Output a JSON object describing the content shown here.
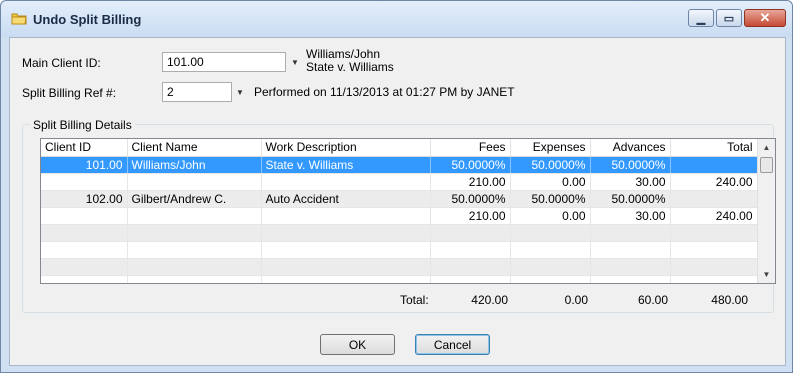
{
  "window": {
    "title": "Undo Split Billing"
  },
  "form": {
    "main_client_label": "Main Client ID:",
    "main_client_value": "101.00",
    "main_client_name": "Williams/John",
    "main_client_case": "State v. Williams",
    "split_ref_label": "Split Billing Ref #:",
    "split_ref_value": "2",
    "performed_text": "Performed on 11/13/2013 at 01:27 PM by JANET"
  },
  "details": {
    "group_title": "Split Billing Details",
    "columns": [
      "Client ID",
      "Client Name",
      "Work Description",
      "Fees",
      "Expenses",
      "Advances",
      "Total"
    ],
    "rows": [
      [
        "101.00",
        "Williams/John",
        "State v. Williams",
        "50.0000%",
        "50.0000%",
        "50.0000%",
        ""
      ],
      [
        "",
        "",
        "",
        "210.00",
        "0.00",
        "30.00",
        "240.00"
      ],
      [
        "102.00",
        "Gilbert/Andrew C.",
        "Auto Accident",
        "50.0000%",
        "50.0000%",
        "50.0000%",
        ""
      ],
      [
        "",
        "",
        "",
        "210.00",
        "0.00",
        "30.00",
        "240.00"
      ]
    ],
    "totals": {
      "label": "Total:",
      "fees": "420.00",
      "expenses": "0.00",
      "advances": "60.00",
      "total": "480.00"
    }
  },
  "buttons": {
    "ok": "OK",
    "cancel": "Cancel"
  }
}
